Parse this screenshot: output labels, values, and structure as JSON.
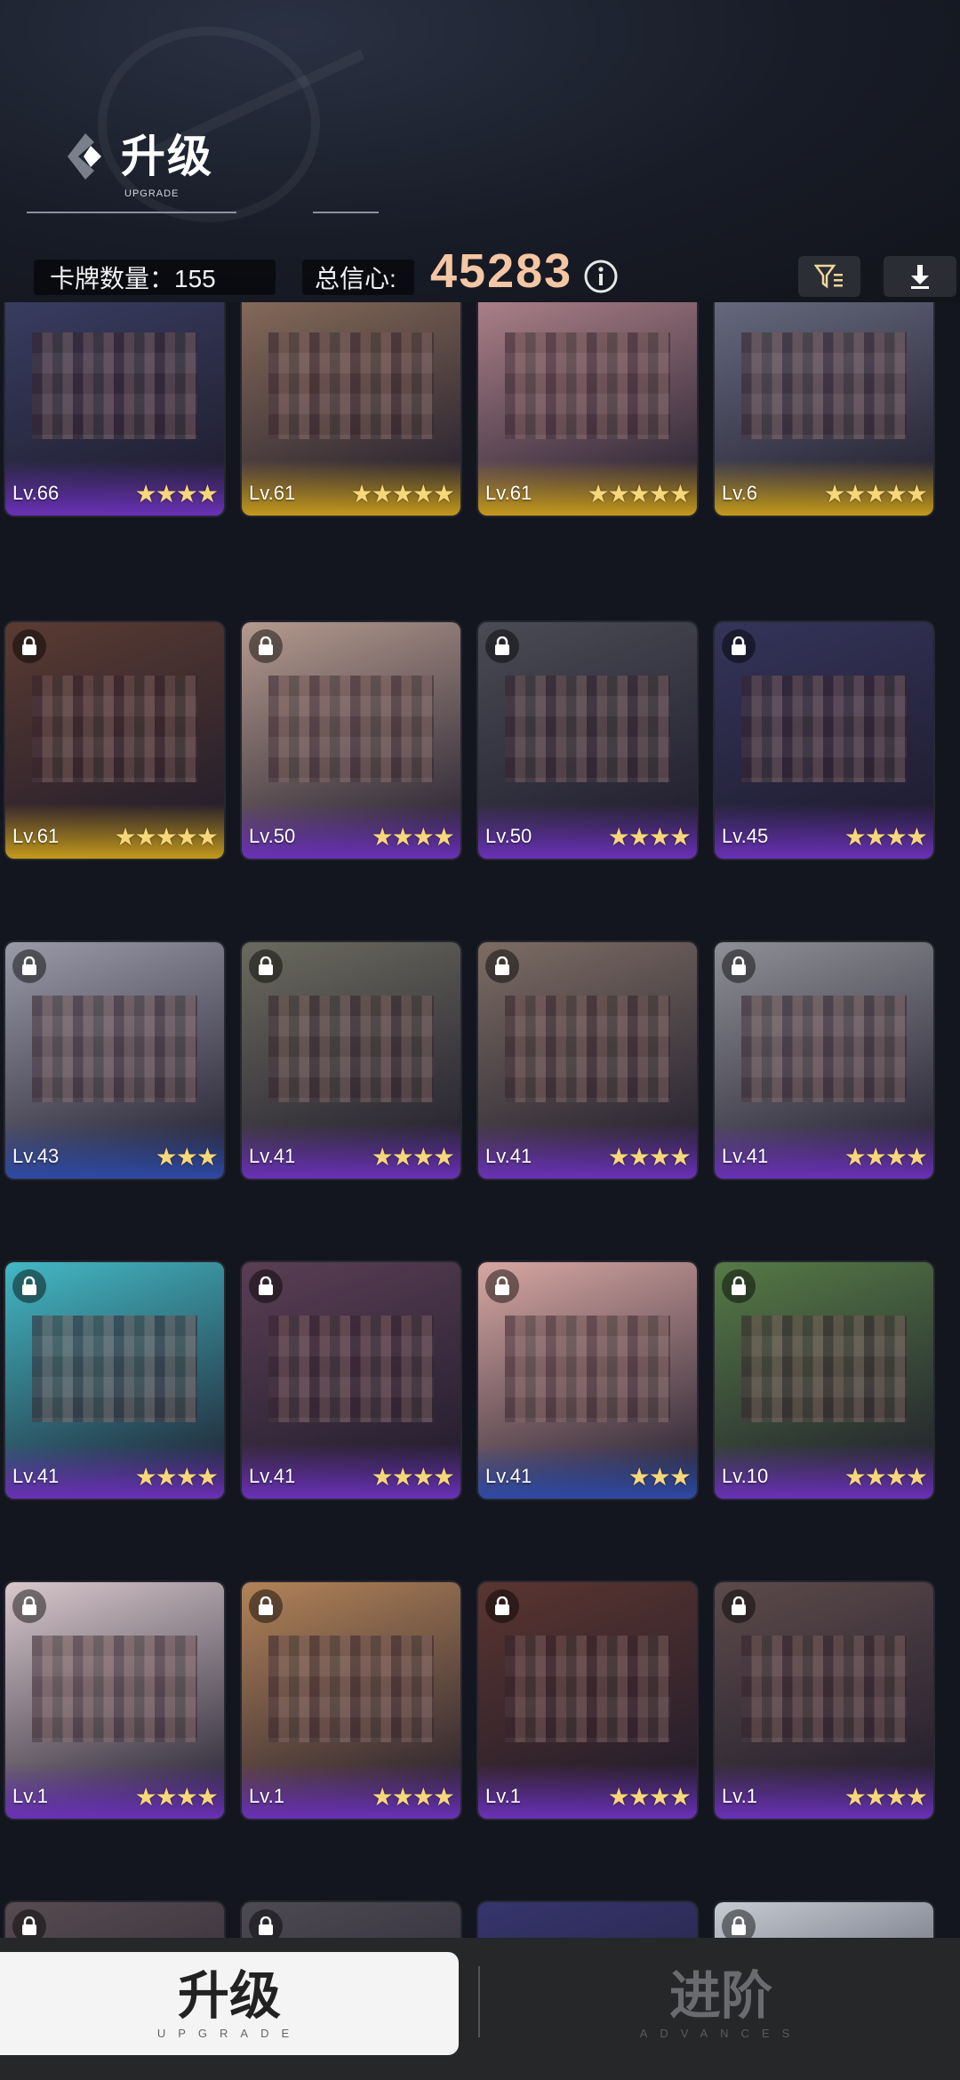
{
  "header": {
    "title": "升级",
    "subtitle": "UPGRADE"
  },
  "stats": {
    "card_count_label": "卡牌数量：155",
    "total_trust_label": "总信心:",
    "total_trust_value": "45283"
  },
  "cards": [
    {
      "level": "Lv.66",
      "stars": 4,
      "locked": false,
      "theme": "purple",
      "art": "#3a3f64"
    },
    {
      "level": "Lv.61",
      "stars": 5,
      "locked": false,
      "theme": "gold",
      "art": "#8c6f5b"
    },
    {
      "level": "Lv.61",
      "stars": 5,
      "locked": false,
      "theme": "gold",
      "art": "#b5878f"
    },
    {
      "level": "Lv.6",
      "stars": 5,
      "locked": false,
      "theme": "gold",
      "art": "#6b6f83"
    },
    {
      "level": "Lv.61",
      "stars": 5,
      "locked": true,
      "theme": "gold",
      "art": "#5a3b32"
    },
    {
      "level": "Lv.50",
      "stars": 4,
      "locked": true,
      "theme": "purple",
      "art": "#b49a8e"
    },
    {
      "level": "Lv.50",
      "stars": 4,
      "locked": true,
      "theme": "purple",
      "art": "#4a4b55"
    },
    {
      "level": "Lv.45",
      "stars": 4,
      "locked": true,
      "theme": "purple",
      "art": "#34345a"
    },
    {
      "level": "Lv.43",
      "stars": 3,
      "locked": true,
      "theme": "blue",
      "art": "#9a9aa8"
    },
    {
      "level": "Lv.41",
      "stars": 4,
      "locked": true,
      "theme": "purple",
      "art": "#6b6a5e"
    },
    {
      "level": "Lv.41",
      "stars": 4,
      "locked": true,
      "theme": "purple",
      "art": "#7c6c63"
    },
    {
      "level": "Lv.41",
      "stars": 4,
      "locked": true,
      "theme": "purple",
      "art": "#8e8f96"
    },
    {
      "level": "Lv.41",
      "stars": 4,
      "locked": true,
      "theme": "purple",
      "art": "#43b8c4"
    },
    {
      "level": "Lv.41",
      "stars": 4,
      "locked": true,
      "theme": "purple",
      "art": "#5a3e54"
    },
    {
      "level": "Lv.41",
      "stars": 3,
      "locked": true,
      "theme": "blue",
      "art": "#d7a7a2"
    },
    {
      "level": "Lv.10",
      "stars": 4,
      "locked": true,
      "theme": "purple",
      "art": "#557a46"
    },
    {
      "level": "Lv.1",
      "stars": 4,
      "locked": true,
      "theme": "purple",
      "art": "#d8c8cc"
    },
    {
      "level": "Lv.1",
      "stars": 4,
      "locked": true,
      "theme": "purple",
      "art": "#b28358"
    },
    {
      "level": "Lv.1",
      "stars": 4,
      "locked": true,
      "theme": "purple",
      "art": "#5a3530"
    },
    {
      "level": "Lv.1",
      "stars": 4,
      "locked": true,
      "theme": "purple",
      "art": "#5c4a4a"
    },
    {
      "level": "",
      "stars": 0,
      "locked": true,
      "theme": "purple",
      "art": "#574b50"
    },
    {
      "level": "",
      "stars": 0,
      "locked": true,
      "theme": "purple",
      "art": "#4d4a53"
    },
    {
      "level": "",
      "stars": 0,
      "locked": false,
      "theme": "purple",
      "art": "#36356e"
    },
    {
      "level": "",
      "stars": 0,
      "locked": true,
      "theme": "purple",
      "art": "#c5cbd3"
    }
  ],
  "tabs": {
    "upgrade_cn": "升级",
    "upgrade_en": "UPGRADE",
    "advance_cn": "进阶",
    "advance_en": "ADVANCES"
  },
  "icons": {
    "info": "info-icon",
    "filter": "filter-icon",
    "download": "download-icon",
    "lock": "lock-icon",
    "star": "star-icon"
  },
  "colors": {
    "trust_value": "#f4c6a3",
    "star": "#f6d77a",
    "gold": "#c59a1b",
    "purple": "#6a31b8",
    "blue": "#2e4aa6"
  }
}
